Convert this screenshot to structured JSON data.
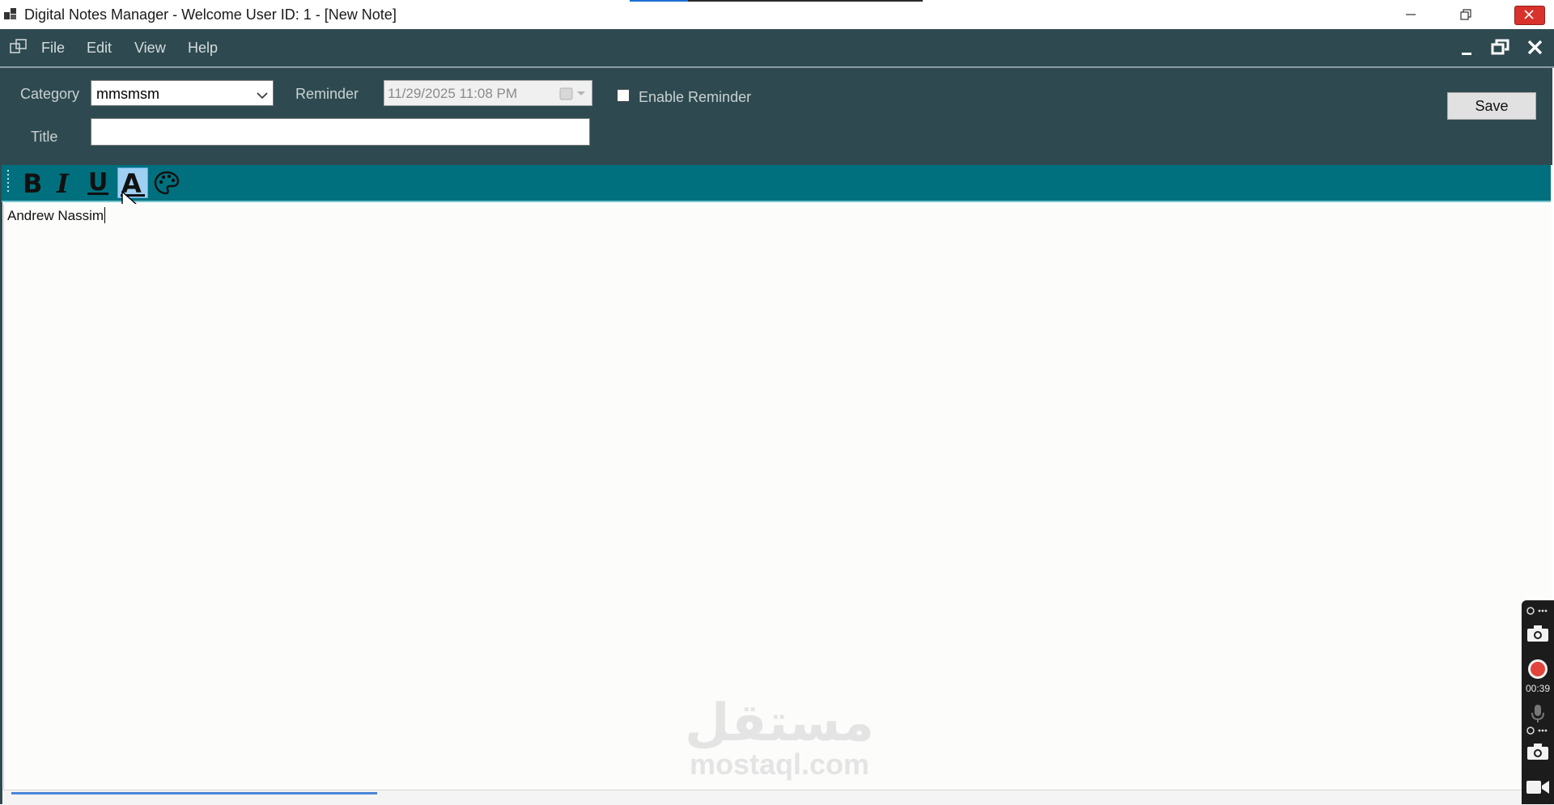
{
  "window": {
    "title": "Digital Notes Manager - Welcome User ID: 1 - [New Note]"
  },
  "menu": {
    "file": "File",
    "edit": "Edit",
    "view": "View",
    "help": "Help"
  },
  "form": {
    "category_label": "Category",
    "category_value": "mmsmsm",
    "reminder_label": "Reminder",
    "reminder_value": "11/29/2025 11:08 PM",
    "enable_reminder_label": "Enable Reminder",
    "enable_reminder_checked": false,
    "title_label": "Title",
    "title_value": "",
    "save_label": "Save"
  },
  "toolbar": {
    "bold": "B",
    "italic": "I",
    "underline": "U",
    "font_color": "A",
    "palette_icon": "palette-icon"
  },
  "editor": {
    "content": "Andrew Nassim"
  },
  "recorder": {
    "timer": "00:39"
  },
  "watermark": {
    "arabic": "مستقل",
    "latin": "mostaql.com"
  },
  "colors": {
    "header_bg": "#2e4a50",
    "toolbar_bg": "#00707e",
    "editor_bg": "#fcfcfb"
  }
}
